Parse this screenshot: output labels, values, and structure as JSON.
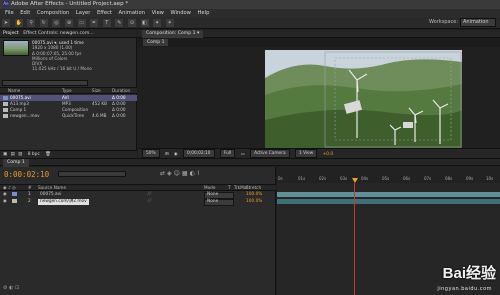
{
  "window": {
    "title": "Adobe After Effects - Untitled Project.aep *"
  },
  "menu": [
    "File",
    "Edit",
    "Composition",
    "Layer",
    "Effect",
    "Animation",
    "View",
    "Window",
    "Help"
  ],
  "workspace": {
    "label": "Workspace:",
    "value": "Animation"
  },
  "project": {
    "tab_label": "Project",
    "effect_tab": "Effect Controls: newgen.com...",
    "info_lines": [
      "00075.avi ▾, used 1 time",
      "1920 x 1080 (1.00)",
      "Δ 0:00:07:05, 25.00 fps",
      "Millions of Colors",
      "DIVX",
      "11.025 kHz / 16 bit U / Mono"
    ],
    "columns": [
      "Name",
      "Type",
      "Size",
      "Duration"
    ],
    "files": [
      {
        "name": "00075.avi",
        "type": "AVI",
        "size": "",
        "dur": "Δ 0:00",
        "color": "#7a8fc9",
        "selected": true
      },
      {
        "name": "A13.mp3",
        "type": "MP3",
        "size": "452 KB",
        "dur": "Δ 0:00",
        "color": "#b9b9b9",
        "selected": false
      },
      {
        "name": "Comp 1",
        "type": "Composition",
        "size": "",
        "dur": "Δ 0:00",
        "color": "#b9b9b9",
        "selected": false
      },
      {
        "name": "newgen...mov",
        "type": "QuickTime",
        "size": "4.6 MB",
        "dur": "Δ 0:00",
        "color": "#b9b9b9",
        "selected": false
      }
    ],
    "bottom_bpc": "8 bpc"
  },
  "composition": {
    "tab_label": "Composition: Comp 1 ▾",
    "subtab": "Comp 1",
    "zoom": "50%",
    "time": "0;00;02;10",
    "quality": "Full",
    "camera": "Active Camera",
    "views": "1 View",
    "exposure": "+0.0"
  },
  "timeline": {
    "tab_label": "Comp 1",
    "timecode": "0:00:02:10",
    "columns": [
      "#",
      "Source Name",
      "Mode",
      "T",
      "TrkMat",
      "Stretch"
    ],
    "layers": [
      {
        "num": "1",
        "name": "00075.avi",
        "mode": "None",
        "stretch": "100.0%",
        "editing": false
      },
      {
        "num": "2",
        "name": "newgen.com/讲2.mov",
        "mode": "None",
        "stretch": "100.0%",
        "editing": true
      }
    ],
    "ruler": [
      "0s",
      "01s",
      "02s",
      "03s",
      "04s",
      "05s",
      "06s",
      "07s",
      "08s",
      "09s",
      "10s"
    ]
  },
  "watermark": {
    "text": "Bai经验",
    "sub": "jingyan.baidu.com"
  }
}
